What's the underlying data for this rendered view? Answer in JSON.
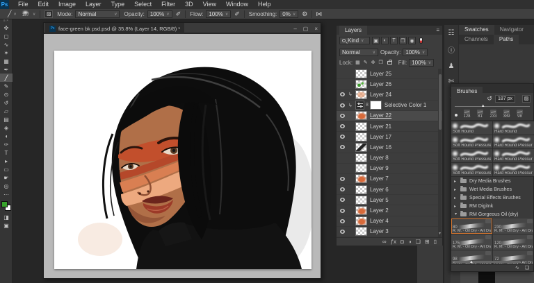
{
  "menu_bar": {
    "logo": "Ps",
    "items": [
      "File",
      "Edit",
      "Image",
      "Layer",
      "Type",
      "Select",
      "Filter",
      "3D",
      "View",
      "Window",
      "Help"
    ]
  },
  "options_bar": {
    "brush_tool_glyph": "╱",
    "brush_size": "187",
    "mode_label": "Mode:",
    "mode_value": "Normal",
    "opacity_label": "Opacity:",
    "opacity_value": "100%",
    "flow_label": "Flow:",
    "flow_value": "100%",
    "smoothing_label": "Smoothing:",
    "smoothing_value": "0%",
    "airbrush_glyph": "✐",
    "gear_glyph": "⚙",
    "symmetry_glyph": "⋈",
    "panel_toggle_glyph": "▨"
  },
  "toolbar": {
    "foreground_color": "#38a32c",
    "background_color": "#ffffff",
    "tools": [
      {
        "glyph": "✜",
        "name": "move-tool"
      },
      {
        "glyph": "◻",
        "name": "marquee-tool"
      },
      {
        "glyph": "∿",
        "name": "lasso-tool"
      },
      {
        "glyph": "✶",
        "name": "quick-selection-tool"
      },
      {
        "glyph": "▦",
        "name": "crop-tool"
      },
      {
        "glyph": "✒",
        "name": "eyedropper-tool"
      },
      {
        "glyph": "╱",
        "name": "brush-tool",
        "active": true
      },
      {
        "glyph": "✎",
        "name": "pencil-tool"
      },
      {
        "glyph": "⊙",
        "name": "clone-stamp-tool"
      },
      {
        "glyph": "↺",
        "name": "history-brush-tool"
      },
      {
        "glyph": "▱",
        "name": "eraser-tool"
      },
      {
        "glyph": "▤",
        "name": "gradient-tool"
      },
      {
        "glyph": "◈",
        "name": "smudge-tool"
      },
      {
        "glyph": "◖",
        "name": "dodge-tool"
      },
      {
        "glyph": "✑",
        "name": "pen-tool"
      },
      {
        "glyph": "T",
        "name": "type-tool"
      },
      {
        "glyph": "▸",
        "name": "path-selection-tool"
      },
      {
        "glyph": "▭",
        "name": "shape-tool"
      },
      {
        "glyph": "☛",
        "name": "hand-tool"
      },
      {
        "glyph": "◎",
        "name": "zoom-tool"
      }
    ],
    "more_glyph": "⋯",
    "extras": [
      {
        "glyph": "◨",
        "name": "quick-mask-button"
      },
      {
        "glyph": "▣",
        "name": "screen-mode-button"
      }
    ]
  },
  "document": {
    "tab_title": "face-green bk psd.psd @ 35.8% (Layer 14, RGB/8) *",
    "file_icon": "Ps",
    "minimize": "–",
    "maximize": "▢",
    "close": "×"
  },
  "layers_panel": {
    "tab": "Layers",
    "menu_glyph": "≡",
    "filter_label": "Kind",
    "filter_icons": [
      {
        "glyph": "▣",
        "name": "filter-pixel-layers-icon"
      },
      {
        "glyph": "◐",
        "name": "filter-adjustment-layers-icon"
      },
      {
        "glyph": "T",
        "name": "filter-type-layers-icon"
      },
      {
        "glyph": "❒",
        "name": "filter-shape-layers-icon"
      },
      {
        "glyph": "◉",
        "name": "filter-smart-objects-icon"
      }
    ],
    "blend_mode": "Normal",
    "opacity_label": "Opacity:",
    "opacity_value": "100%",
    "lock_label": "Lock:",
    "lock_icons": [
      {
        "glyph": "▦",
        "name": "lock-transparency-icon"
      },
      {
        "glyph": "✎",
        "name": "lock-pixels-icon"
      },
      {
        "glyph": "✜",
        "name": "lock-position-icon"
      },
      {
        "glyph": "❒",
        "name": "lock-artboard-icon"
      }
    ],
    "fill_label": "Fill:",
    "fill_value": "100%",
    "layers": [
      {
        "name": "Layer 25",
        "eye": false,
        "thumb": "checker"
      },
      {
        "name": "Layer 26",
        "eye": false,
        "thumb": "green"
      },
      {
        "name": "Layer 24",
        "eye": true,
        "clip": true,
        "thumb": "pale"
      },
      {
        "name": "Selective Color 1",
        "eye": true,
        "clip": true,
        "adj": true,
        "thumb": "white"
      },
      {
        "name": "Layer 22",
        "eye": true,
        "active": true,
        "thumb": "orange"
      },
      {
        "name": "Layer 21",
        "eye": true,
        "thumb": "checker"
      },
      {
        "name": "Layer 17",
        "eye": true,
        "thumb": "checker"
      },
      {
        "name": "Layer 16",
        "eye": true,
        "thumb": "dark"
      },
      {
        "name": "Layer 8",
        "eye": false,
        "thumb": "checker"
      },
      {
        "name": "Layer 9",
        "eye": false,
        "thumb": "checker"
      },
      {
        "name": "Layer 7",
        "eye": true,
        "thumb": "orange"
      },
      {
        "name": "Layer 6",
        "eye": true,
        "thumb": "checker"
      },
      {
        "name": "Layer 5",
        "eye": true,
        "thumb": "checker"
      },
      {
        "name": "Layer 2",
        "eye": true,
        "thumb": "orange"
      },
      {
        "name": "Layer 4",
        "eye": true,
        "thumb": "orange"
      },
      {
        "name": "Layer 3",
        "eye": true,
        "thumb": "checker"
      }
    ],
    "bottom_icons": [
      {
        "glyph": "∞",
        "name": "link-layers-icon"
      },
      {
        "glyph": "ƒx",
        "name": "layer-style-icon"
      },
      {
        "glyph": "◘",
        "name": "layer-mask-icon"
      },
      {
        "glyph": "◑",
        "name": "adjustment-layer-icon"
      },
      {
        "glyph": "❏",
        "name": "layer-group-icon"
      },
      {
        "glyph": "⊞",
        "name": "new-layer-icon"
      },
      {
        "glyph": "▯",
        "name": "delete-layer-icon"
      }
    ]
  },
  "dock": {
    "strip_icons": [
      {
        "glyph": "☷",
        "name": "color-panel-icon"
      },
      {
        "glyph": "ⓘ",
        "name": "info-panel-icon"
      },
      {
        "glyph": "♟",
        "name": "history-panel-icon"
      },
      {
        "glyph": "✄",
        "name": "actions-panel-icon"
      },
      {
        "glyph": "◔",
        "name": "clone-source-panel-icon"
      }
    ],
    "tabs_row1": [
      {
        "label": "Swatches",
        "active": true
      },
      {
        "label": "Navigator",
        "active": false
      }
    ],
    "tabs_row2": [
      {
        "label": "Channels",
        "active": false
      },
      {
        "label": "Paths",
        "active": true
      }
    ]
  },
  "brushes_panel": {
    "tab": "Brushes",
    "reset_glyph": "↺",
    "size_value": "187 px",
    "pressure_toggle_glyph": "▨",
    "slider_thumb_glyph": "▲",
    "recent": [
      {
        "size": "128"
      },
      {
        "size": "81"
      },
      {
        "size": "233"
      },
      {
        "size": "389"
      },
      {
        "size": "98"
      }
    ],
    "defaults": [
      {
        "name": "Soft Round",
        "tip": "soft"
      },
      {
        "name": "Hard Round",
        "tip": "hard"
      },
      {
        "name": "Soft Round Pressure Size",
        "tip": "soft"
      },
      {
        "name": "Hard Round Pressure Size",
        "tip": "hard"
      },
      {
        "name": "Soft Round Pressure Opacity",
        "tip": "soft"
      },
      {
        "name": "Hard Round Pressure Opacity",
        "tip": "hard"
      },
      {
        "name": "Soft Round Pressure Opacity…",
        "tip": "soft"
      },
      {
        "name": "Hard Round Pressure Opacit…",
        "tip": "hard"
      }
    ],
    "folders": [
      {
        "name": "Dry Media Brushes",
        "open": false
      },
      {
        "name": "Wet Media Brushes",
        "open": false
      },
      {
        "name": "Special Effects Brushes",
        "open": false
      },
      {
        "name": "RM DigiInk",
        "open": false
      },
      {
        "name": "RM Gorgeous Oil (dry)",
        "open": true
      }
    ],
    "presets": [
      {
        "size": "80",
        "label": "R. M. - Oil Dry - Art Draft Hal..",
        "sel": true
      },
      {
        "size": "230",
        "label": "R. M. - Oil Dry - Art Draft Ha.."
      },
      {
        "size": "175",
        "label": "R. M. - Oil Dry - Art Draft Hal.."
      },
      {
        "size": "120",
        "label": "R. M. - Oil Dry - Art Draft Ha.."
      },
      {
        "size": "98",
        "label": "R. M. - Oil Dry - Art Draft Hal.."
      },
      {
        "size": "72",
        "label": "R. M. - Oil Dry - Art Draft Ha.."
      },
      {
        "size": "",
        "label": ""
      },
      {
        "size": "",
        "label": ""
      }
    ],
    "footer_icons": [
      {
        "glyph": "∿",
        "name": "stroke-preview-toggle-icon"
      },
      {
        "glyph": "❏",
        "name": "new-brush-group-icon"
      }
    ]
  }
}
